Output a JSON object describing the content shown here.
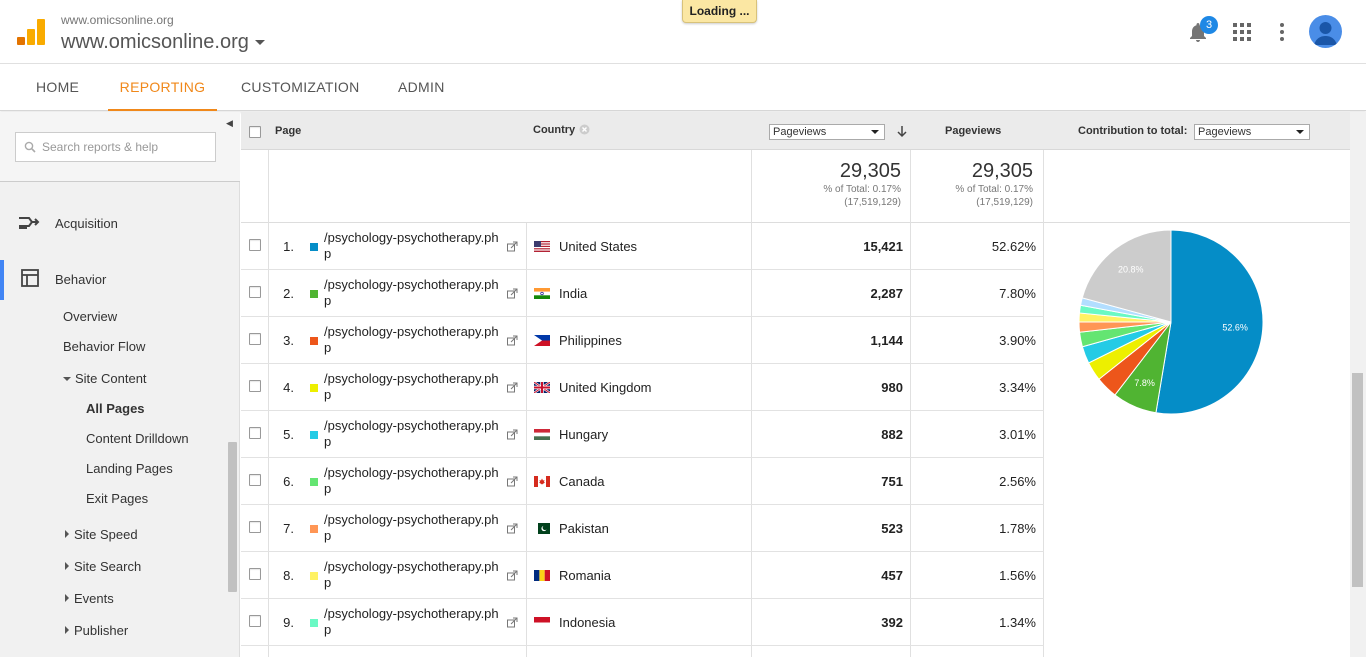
{
  "header": {
    "account_small": "www.omicsonline.org",
    "account_main": "www.omicsonline.org",
    "loading": "Loading ...",
    "notification_count": "3",
    "icons": [
      "analytics-logo-icon",
      "bell-icon",
      "apps-grid-icon",
      "more-vert-icon",
      "avatar-icon"
    ]
  },
  "nav": {
    "tabs": [
      {
        "label": "HOME",
        "active": false
      },
      {
        "label": "REPORTING",
        "active": true
      },
      {
        "label": "CUSTOMIZATION",
        "active": false
      },
      {
        "label": "ADMIN",
        "active": false
      }
    ]
  },
  "sidebar": {
    "search_placeholder": "Search reports & help",
    "sections": {
      "acquisition": "Acquisition",
      "behavior": "Behavior"
    },
    "items": {
      "overview": "Overview",
      "behavior_flow": "Behavior Flow",
      "site_content": "Site Content",
      "all_pages": "All Pages",
      "content_drilldown": "Content Drilldown",
      "landing_pages": "Landing Pages",
      "exit_pages": "Exit Pages",
      "site_speed": "Site Speed",
      "site_search": "Site Search",
      "events": "Events",
      "publisher": "Publisher"
    }
  },
  "table": {
    "headers": {
      "page": "Page",
      "country": "Country",
      "sort_select": "Pageviews",
      "pageviews": "Pageviews",
      "contribution": "Contribution to total:",
      "contribution_select": "Pageviews"
    },
    "totals": {
      "value": "29,305",
      "pct": "% of Total: 0.17%",
      "total": "(17,519,129)"
    },
    "rows": [
      {
        "rank": "1.",
        "page": "/psychology-psychotherapy.php",
        "country": "United States",
        "pageviews": "15,421",
        "pct": "52.62%",
        "color": "#058dc7"
      },
      {
        "rank": "2.",
        "page": "/psychology-psychotherapy.php",
        "country": "India",
        "pageviews": "2,287",
        "pct": "7.80%",
        "color": "#50b432"
      },
      {
        "rank": "3.",
        "page": "/psychology-psychotherapy.php",
        "country": "Philippines",
        "pageviews": "1,144",
        "pct": "3.90%",
        "color": "#ed561b"
      },
      {
        "rank": "4.",
        "page": "/psychology-psychotherapy.php",
        "country": "United Kingdom",
        "pageviews": "980",
        "pct": "3.34%",
        "color": "#edef00"
      },
      {
        "rank": "5.",
        "page": "/psychology-psychotherapy.php",
        "country": "Hungary",
        "pageviews": "882",
        "pct": "3.01%",
        "color": "#24cbe5"
      },
      {
        "rank": "6.",
        "page": "/psychology-psychotherapy.php",
        "country": "Canada",
        "pageviews": "751",
        "pct": "2.56%",
        "color": "#64e572"
      },
      {
        "rank": "7.",
        "page": "/psychology-psychotherapy.php",
        "country": "Pakistan",
        "pageviews": "523",
        "pct": "1.78%",
        "color": "#ff9655"
      },
      {
        "rank": "8.",
        "page": "/psychology-psychotherapy.php",
        "country": "Romania",
        "pageviews": "457",
        "pct": "1.56%",
        "color": "#fff263"
      },
      {
        "rank": "9.",
        "page": "/psychology-psychotherapy.php",
        "country": "Indonesia",
        "pageviews": "392",
        "pct": "1.34%",
        "color": "#6af9c4"
      }
    ]
  },
  "pie": {
    "slices": [
      {
        "value": 52.62,
        "color": "#058dc7",
        "label": "52.6%"
      },
      {
        "value": 7.8,
        "color": "#50b432",
        "label": "7.8%"
      },
      {
        "value": 3.9,
        "color": "#ed561b",
        "label": ""
      },
      {
        "value": 3.34,
        "color": "#edef00",
        "label": ""
      },
      {
        "value": 3.01,
        "color": "#24cbe5",
        "label": ""
      },
      {
        "value": 2.56,
        "color": "#64e572",
        "label": ""
      },
      {
        "value": 1.78,
        "color": "#ff9655",
        "label": ""
      },
      {
        "value": 1.56,
        "color": "#fff263",
        "label": ""
      },
      {
        "value": 1.34,
        "color": "#6af9c4",
        "label": ""
      },
      {
        "value": 1.32,
        "color": "#b2deff",
        "label": ""
      },
      {
        "value": 20.77,
        "color": "#cccccc",
        "label": "20.8%"
      }
    ]
  }
}
